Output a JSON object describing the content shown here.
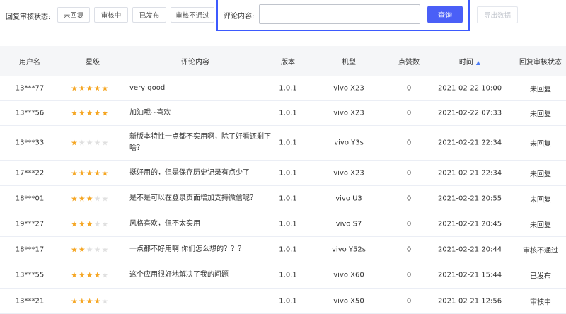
{
  "filter": {
    "status_label": "回复审核状态:",
    "statuses": [
      "未回复",
      "审核中",
      "已发布",
      "审核不通过"
    ]
  },
  "search": {
    "label": "评论内容:",
    "value": "",
    "placeholder": "",
    "button": "查询"
  },
  "export_label": "导出数据",
  "columns": {
    "user": "用户名",
    "rating": "星级",
    "comment": "评论内容",
    "version": "版本",
    "model": "机型",
    "likes": "点赞数",
    "time": "时间",
    "status": "回复审核状态"
  },
  "icons": {
    "sort": "sort-icon",
    "star": "star-icon"
  },
  "colors": {
    "accent": "#4a5ff7",
    "star": "#f5a623",
    "star_empty": "#e0e0e0",
    "header_bg": "#f5f6f8"
  },
  "rows": [
    {
      "user": "13***77",
      "rating": 5,
      "comment": "very good",
      "version": "1.0.1",
      "model": "vivo X23",
      "likes": "0",
      "time": "2021-02-22 10:00",
      "status": "未回复"
    },
    {
      "user": "13***56",
      "rating": 5,
      "comment": "加油哦~喜欢",
      "version": "1.0.1",
      "model": "vivo X23",
      "likes": "0",
      "time": "2021-02-22 07:33",
      "status": "未回复"
    },
    {
      "user": "13***33",
      "rating": 1,
      "comment": "新版本特性一点都不实用啊，除了好看还剩下啥？",
      "version": "1.0.1",
      "model": "vivo Y3s",
      "likes": "0",
      "time": "2021-02-21 22:34",
      "status": "未回复"
    },
    {
      "user": "17***22",
      "rating": 5,
      "comment": "挺好用的，但是保存历史记录有点少了",
      "version": "1.0.1",
      "model": "vivo X23",
      "likes": "0",
      "time": "2021-02-21 22:34",
      "status": "未回复"
    },
    {
      "user": "18***01",
      "rating": 3,
      "comment": "是不是可以在登录页面增加支持微信呢？",
      "version": "1.0.1",
      "model": "vivo U3",
      "likes": "0",
      "time": "2021-02-21 20:55",
      "status": "未回复"
    },
    {
      "user": "19***27",
      "rating": 3,
      "comment": "风格喜欢，但不太实用",
      "version": "1.0.1",
      "model": "vivo S7",
      "likes": "0",
      "time": "2021-02-21 20:45",
      "status": "未回复"
    },
    {
      "user": "18***17",
      "rating": 2,
      "comment": "一点都不好用啊 你们怎么想的？？？",
      "version": "1.0.1",
      "model": "vivo Y52s",
      "likes": "0",
      "time": "2021-02-21 20:44",
      "status": "审核不通过"
    },
    {
      "user": "13***55",
      "rating": 4,
      "comment": "这个应用很好地解决了我的问题",
      "version": "1.0.1",
      "model": "vivo X60",
      "likes": "0",
      "time": "2021-02-21 15:44",
      "status": "已发布"
    },
    {
      "user": "13***21",
      "rating": 4,
      "comment": "",
      "version": "1.0.1",
      "model": "vivo X50",
      "likes": "0",
      "time": "2021-02-21 12:56",
      "status": "审核中"
    }
  ]
}
